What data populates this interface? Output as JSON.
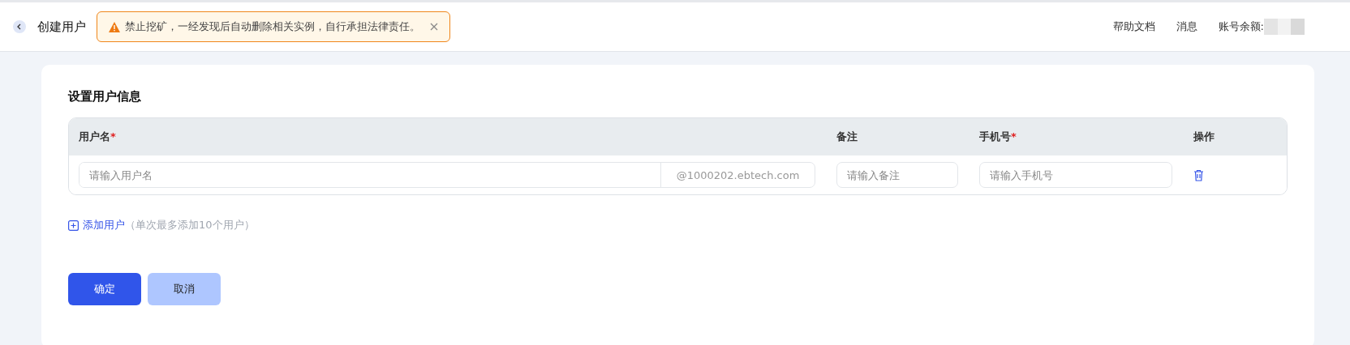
{
  "header": {
    "title": "创建用户",
    "alert": {
      "text": "禁止挖矿，一经发现后自动删除相关实例，自行承担法律责任。",
      "closable": true
    },
    "links": [
      "帮助文档",
      "消息"
    ],
    "balance_label": "账号余额:"
  },
  "form": {
    "title": "设置用户信息",
    "columns": [
      {
        "label": "用户名",
        "required_mark": "*"
      },
      {
        "label": "备注"
      },
      {
        "label": "手机号",
        "required_mark": "*"
      },
      {
        "label": "操作"
      }
    ],
    "rows": [
      {
        "username": {
          "placeholder": "请输入用户名",
          "suffix": "@1000202.ebtech.com"
        },
        "remark": {
          "placeholder": "请输入备注"
        },
        "phone": {
          "placeholder": "请输入手机号"
        }
      }
    ],
    "add_link": "添加用户",
    "add_hint": "（单次最多添加10个用户）",
    "buttons": [
      {
        "label": "确定",
        "kind": "primary"
      },
      {
        "label": "取消",
        "kind": "secondary"
      }
    ]
  }
}
